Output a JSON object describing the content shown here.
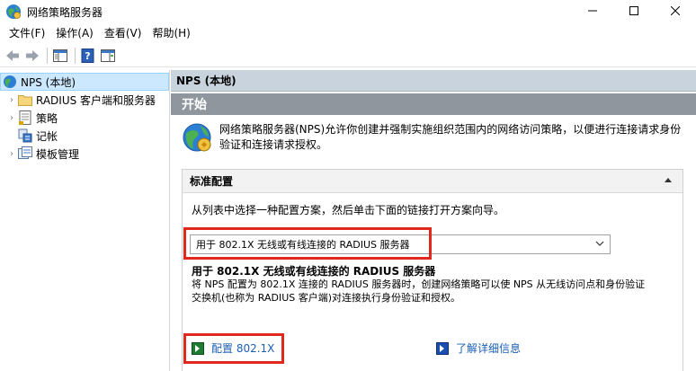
{
  "window": {
    "title": "网络策略服务器"
  },
  "menu": {
    "items": [
      "文件(F)",
      "操作(A)",
      "查看(V)",
      "帮助(H)"
    ]
  },
  "tree": {
    "items": [
      {
        "label": "NPS (本地)",
        "icon": "nps-globe-icon",
        "selected": true,
        "expandable": false
      },
      {
        "label": "RADIUS 客户端和服务器",
        "icon": "folder-icon",
        "selected": false,
        "expandable": true
      },
      {
        "label": "策略",
        "icon": "policy-icon",
        "selected": false,
        "expandable": true
      },
      {
        "label": "记帐",
        "icon": "accounting-icon",
        "selected": false,
        "expandable": false
      },
      {
        "label": "模板管理",
        "icon": "template-icon",
        "selected": false,
        "expandable": true
      }
    ]
  },
  "right": {
    "header": "NPS (本地)",
    "start": "开始",
    "intro_line1": "网络策略服务器(NPS)允许你创建并强制实施组织范围内的网络访问策略，以便进行连接请求身份",
    "intro_line2": "验证和连接请求授权。",
    "standard_config": {
      "heading": "标准配置",
      "description": "从列表中选择一种配置方案，然后单击下面的链接打开方案向导。",
      "selected_option": "用于 802.1X 无线或有线连接的 RADIUS 服务器",
      "sub_title": "用于 802.1X 无线或有线连接的 RADIUS 服务器",
      "sub_desc_line1": "将 NPS 配置为 802.1X 连接的 RADIUS 服务器时，创建网络策略可以使 NPS 从无线访问点和身份验证",
      "sub_desc_line2": "交换机(也称为 RADIUS 客户端)对连接执行身份验证和授权。",
      "configure_link": "配置 802.1X",
      "learn_more_link": "了解详细信息"
    }
  },
  "colors": {
    "highlight": "#e0281e",
    "header_bar": "#c9d3de",
    "start_bar": "#8f969e",
    "link": "#1a5fb4"
  }
}
